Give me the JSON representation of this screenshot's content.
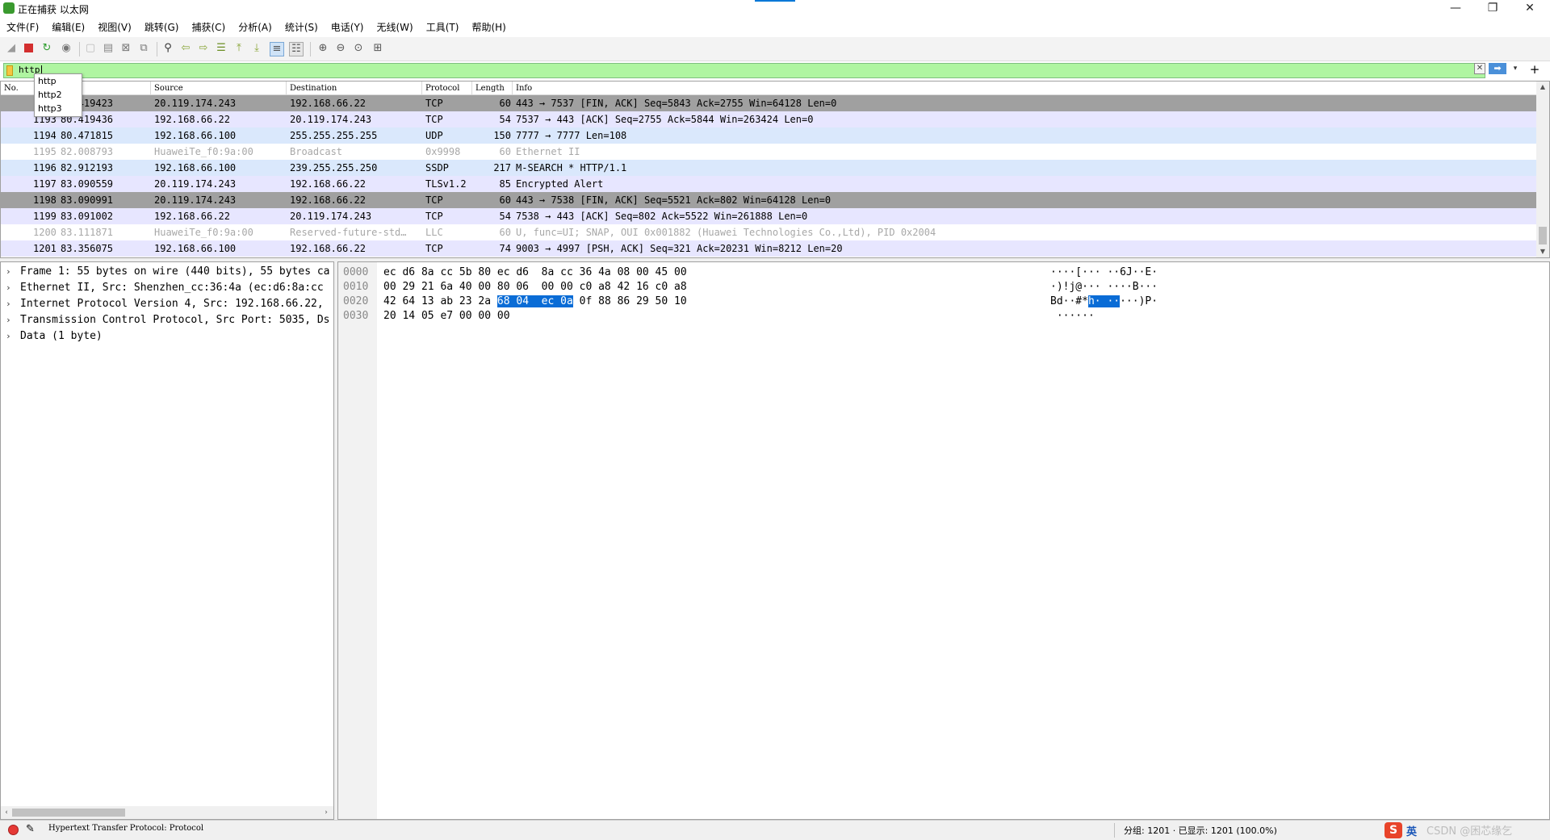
{
  "window": {
    "title": "正在捕获 以太网",
    "minimize_icon": "—",
    "maximize_icon": "❐",
    "close_icon": "✕"
  },
  "menu": [
    "文件(F)",
    "编辑(E)",
    "视图(V)",
    "跳转(G)",
    "捕获(C)",
    "分析(A)",
    "统计(S)",
    "电话(Y)",
    "无线(W)",
    "工具(T)",
    "帮助(H)"
  ],
  "filter": {
    "value": "http",
    "autocomplete": [
      "http",
      "http2",
      "http3"
    ],
    "clear_icon": "✕",
    "apply_icon": "➡",
    "dropdown_icon": "▾",
    "add_icon": "+",
    "colors": {
      "background": "#aff5a1"
    }
  },
  "packet_list": {
    "columns": [
      "No.",
      "Source",
      "Destination",
      "Protocol",
      "Length",
      "Info"
    ],
    "rows": [
      {
        "no": "1193",
        "time": "80.419423",
        "source": "20.119.174.243",
        "destination": "192.168.66.22",
        "protocol": "TCP",
        "length": "60",
        "info": "443 → 7537 [FIN, ACK] Seq=5843 Ack=2755 Win=64128 Len=0",
        "style": "dark"
      },
      {
        "no": "1193",
        "time": "80.419436",
        "source": "192.168.66.22",
        "destination": "20.119.174.243",
        "protocol": "TCP",
        "length": "54",
        "info": "7537 → 443 [ACK] Seq=2755 Ack=5844 Win=263424 Len=0",
        "style": "lav"
      },
      {
        "no": "1194",
        "time": "80.471815",
        "source": "192.168.66.100",
        "destination": "255.255.255.255",
        "protocol": "UDP",
        "length": "150",
        "info": "7777 → 7777 Len=108",
        "style": "blue"
      },
      {
        "no": "1195",
        "time": "82.008793",
        "source": "HuaweiTe_f0:9a:00",
        "destination": "Broadcast",
        "protocol": "0x9998",
        "length": "60",
        "info": "Ethernet II",
        "style": "white-gray"
      },
      {
        "no": "1196",
        "time": "82.912193",
        "source": "192.168.66.100",
        "destination": "239.255.255.250",
        "protocol": "SSDP",
        "length": "217",
        "info": "M-SEARCH * HTTP/1.1",
        "style": "blue"
      },
      {
        "no": "1197",
        "time": "83.090559",
        "source": "20.119.174.243",
        "destination": "192.168.66.22",
        "protocol": "TLSv1.2",
        "length": "85",
        "info": "Encrypted Alert",
        "style": "lav"
      },
      {
        "no": "1198",
        "time": "83.090991",
        "source": "20.119.174.243",
        "destination": "192.168.66.22",
        "protocol": "TCP",
        "length": "60",
        "info": "443 → 7538 [FIN, ACK] Seq=5521 Ack=802 Win=64128 Len=0",
        "style": "dark"
      },
      {
        "no": "1199",
        "time": "83.091002",
        "source": "192.168.66.22",
        "destination": "20.119.174.243",
        "protocol": "TCP",
        "length": "54",
        "info": "7538 → 443 [ACK] Seq=802 Ack=5522 Win=261888 Len=0",
        "style": "lav"
      },
      {
        "no": "1200",
        "time": "83.111871",
        "source": "HuaweiTe_f0:9a:00",
        "destination": "Reserved-future-std…",
        "protocol": "LLC",
        "length": "60",
        "info": "U, func=UI; SNAP, OUI 0x001882 (Huawei Technologies Co.,Ltd), PID 0x2004",
        "style": "white-gray"
      },
      {
        "no": "1201",
        "time": "83.356075",
        "source": "192.168.66.100",
        "destination": "192.168.66.22",
        "protocol": "TCP",
        "length": "74",
        "info": "9003 → 4997 [PSH, ACK] Seq=321 Ack=20231 Win=8212 Len=20",
        "style": "lav"
      }
    ],
    "row_colors": {
      "dark": "#a0a0a0",
      "lav": "#e7e6ff",
      "blue": "#dae8fc",
      "white-gray": "#ffffff"
    },
    "scroll_up_icon": "▲",
    "scroll_down_icon": "▼"
  },
  "details": {
    "items": [
      "Frame 1: 55 bytes on wire (440 bits), 55 bytes ca",
      "Ethernet II, Src: Shenzhen_cc:36:4a (ec:d6:8a:cc",
      "Internet Protocol Version 4, Src: 192.168.66.22,",
      "Transmission Control Protocol, Src Port: 5035, Ds",
      "Data (1 byte)"
    ],
    "expand_icon": "›",
    "scroll_left_icon": "‹",
    "scroll_right_icon": "›"
  },
  "bytes": {
    "lines": [
      {
        "offset": "0000",
        "hex_a": "ec d6 8a cc 5b 80 ec d6  8a cc 36 4a 08 00 45 00",
        "hex_hl": "",
        "hex_b": "",
        "ascii_a": "····[··· ··6J··E·",
        "ascii_hl": "",
        "ascii_b": ""
      },
      {
        "offset": "0010",
        "hex_a": "00 29 21 6a 40 00 80 06  00 00 c0 a8 42 16 c0 a8",
        "hex_hl": "",
        "hex_b": "",
        "ascii_a": "·)!j@··· ····B···",
        "ascii_hl": "",
        "ascii_b": ""
      },
      {
        "offset": "0020",
        "hex_a": "42 64 13 ab 23 2a ",
        "hex_hl": "68 04  ec 0a",
        "hex_b": " 0f 88 86 29 50 10",
        "ascii_a": "Bd··#*",
        "ascii_hl": "h· ··",
        "ascii_b": "···)P·"
      },
      {
        "offset": "0030",
        "hex_a": "20 14 05 e7 00 00 00",
        "hex_hl": "",
        "hex_b": "",
        "ascii_a": " ······",
        "ascii_hl": "",
        "ascii_b": ""
      }
    ],
    "highlight_color": "#0a6cd6"
  },
  "status": {
    "text": "Hypertext Transfer Protocol: Protocol",
    "edit_icon": "✎",
    "packets": "分组: 1201 · 已显示: 1201 (100.0%)",
    "tray_logo": "S",
    "tray_lang": "英",
    "watermark": "CSDN @困芯缘乞"
  },
  "toolbar_icons": [
    "shark-fin-icon",
    "stop-icon",
    "restart-icon",
    "options-icon",
    "open-icon",
    "save-icon",
    "close-file-icon",
    "reload-icon",
    "find-icon",
    "back-icon",
    "forward-icon",
    "goto-icon",
    "first-icon",
    "last-icon",
    "autoscroll-icon",
    "colorize-icon",
    "zoom-in-icon",
    "zoom-out-icon",
    "zoom-normal-icon",
    "resize-columns-icon"
  ]
}
